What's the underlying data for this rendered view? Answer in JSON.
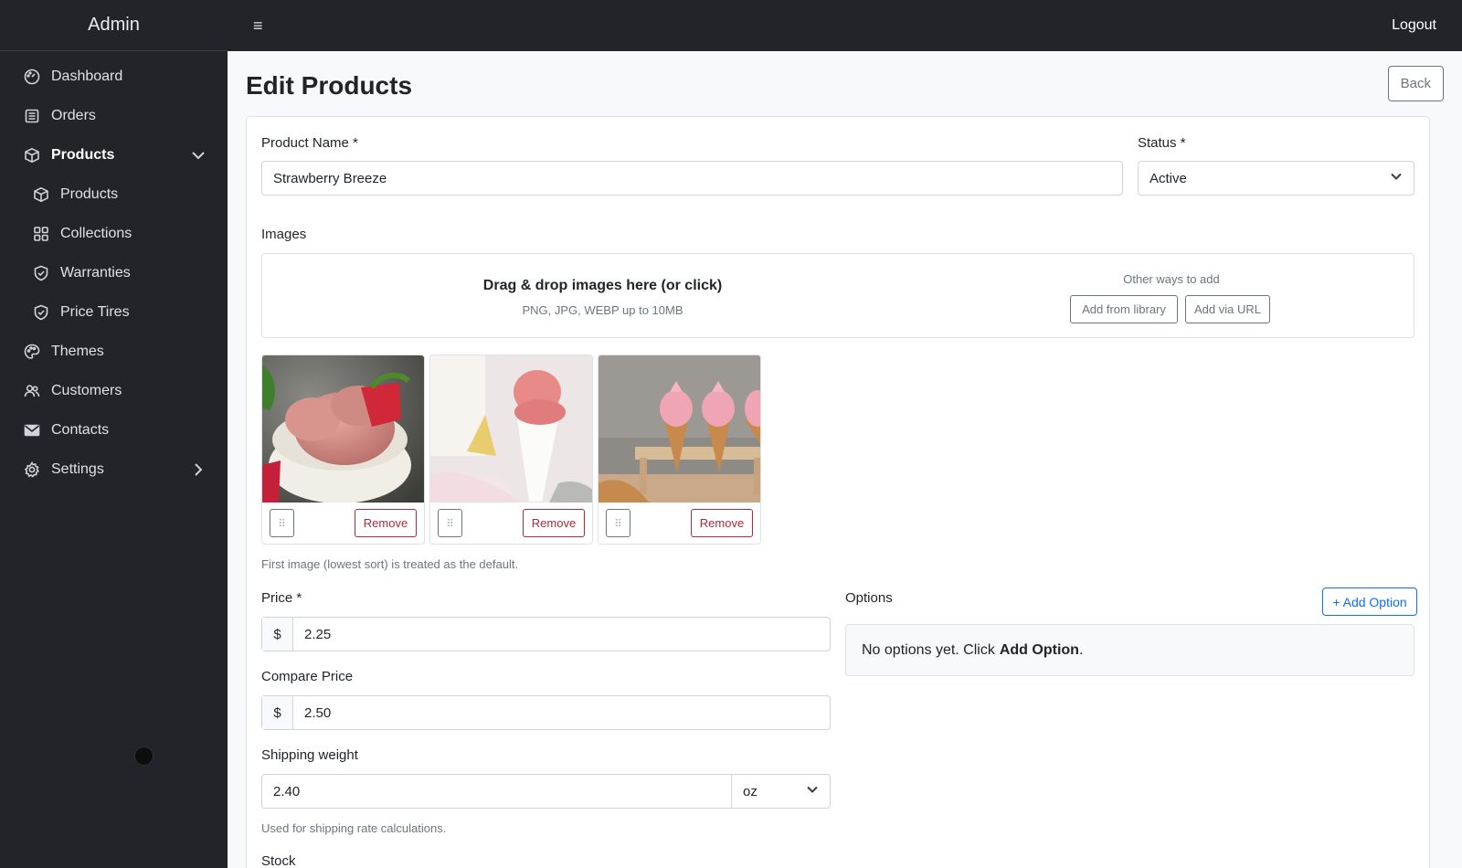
{
  "sidebar": {
    "brand": "Admin",
    "items": [
      {
        "label": "Dashboard",
        "icon": "dashboard-icon"
      },
      {
        "label": "Orders",
        "icon": "orders-icon"
      },
      {
        "label": "Products",
        "icon": "box-icon",
        "expanded": true
      },
      {
        "label": "Products",
        "icon": "box-icon"
      },
      {
        "label": "Collections",
        "icon": "grid-icon"
      },
      {
        "label": "Warranties",
        "icon": "shield-icon"
      },
      {
        "label": "Price Tires",
        "icon": "shield-icon"
      },
      {
        "label": "Themes",
        "icon": "palette-icon"
      },
      {
        "label": "Customers",
        "icon": "users-icon"
      },
      {
        "label": "Contacts",
        "icon": "envelope-icon"
      },
      {
        "label": "Settings",
        "icon": "gear-icon"
      }
    ]
  },
  "topbar": {
    "menu_glyph": "≡",
    "logout": "Logout"
  },
  "page": {
    "title": "Edit Products",
    "back": "Back"
  },
  "form": {
    "product_name_label": "Product Name *",
    "product_name_value": "Strawberry Breeze",
    "status_label": "Status *",
    "status_value": "Active",
    "images_label": "Images",
    "dropzone_title": "Drag & drop images here (or click)",
    "dropzone_sub": "PNG, JPG, WEBP up to 10MB",
    "other_ways": "Other ways to add",
    "add_library": "Add from library",
    "add_url": "Add via URL",
    "remove": "Remove",
    "drag_glyph": "⠿",
    "image_hint": "First image (lowest sort) is treated as the default.",
    "price_label": "Price *",
    "currency": "$",
    "price_value": "2.25",
    "compare_label": "Compare Price",
    "compare_value": "2.50",
    "ship_label": "Shipping weight",
    "ship_value": "2.40",
    "ship_unit": "oz",
    "ship_hint": "Used for shipping rate calculations.",
    "stock_label": "Stock",
    "options_label": "Options",
    "add_option": "+ Add Option",
    "no_options": "No options yet. Click",
    "no_options_strong": "Add Option",
    "no_options_end": "."
  }
}
